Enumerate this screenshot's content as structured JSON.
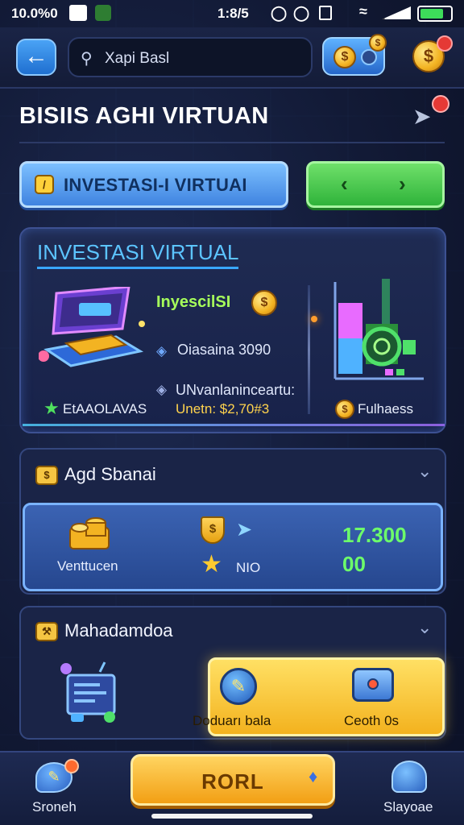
{
  "status_bar": {
    "time": "10.0%0",
    "center": "1:8/5"
  },
  "search": {
    "placeholder": "Xapi Basl"
  },
  "header": {
    "title": "BISIIS AGHI VIRTUAN"
  },
  "tabs": {
    "invest_label": "INVESTASI-I VIRTUAI"
  },
  "invest_panel": {
    "title": "INVESTASI VIRTUAL",
    "subtitle": "InyescilSI",
    "line1": "Oiasaina 3090",
    "line2": "UNvanlaninceartu:",
    "line3": "Unetn: $2,70#3",
    "star_label": "EtAAOLAVAS",
    "fund_label": "Fulhaess"
  },
  "agd_panel": {
    "title": "Agd Sbanai",
    "label_left": "Venttucen",
    "label_mid": "NIO",
    "value_top": "17.300",
    "value_bottom": "00"
  },
  "maha_panel": {
    "title": "Mahadamdoa",
    "card_label_1": "Doduarı bala",
    "card_label_2": "Ceoth 0s"
  },
  "bottom_nav": {
    "left_label": "Sroneh",
    "main_label": "RORL",
    "right_label": "Slayoae"
  },
  "colors": {
    "accent_blue": "#3f83e0",
    "accent_green": "#2fb33a",
    "accent_yellow": "#f3b21e",
    "value_green": "#6dff6a"
  }
}
